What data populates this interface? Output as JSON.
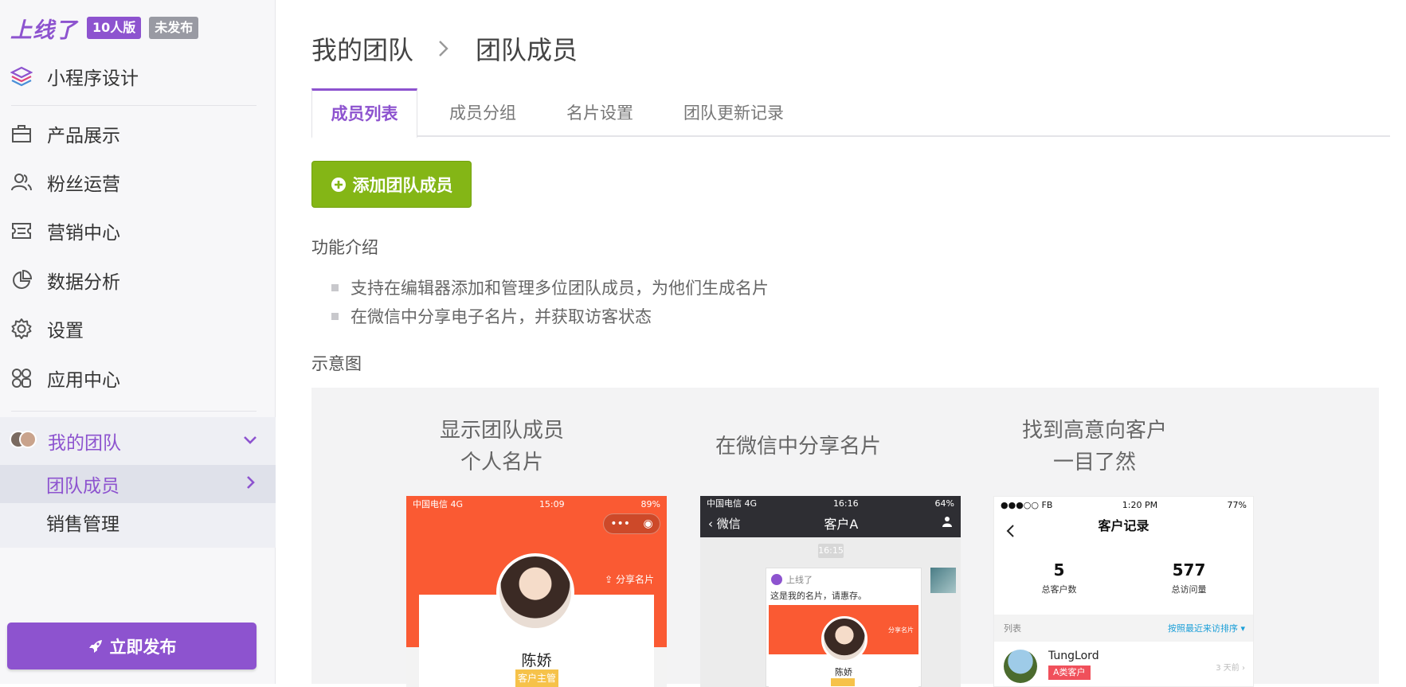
{
  "brand": {
    "logo": "上线了",
    "plan_badge": "10人版",
    "status_badge": "未发布"
  },
  "sidebar": {
    "design": "小程序设计",
    "items": [
      {
        "label": "产品展示",
        "icon": "briefcase-icon"
      },
      {
        "label": "粉丝运营",
        "icon": "users-icon"
      },
      {
        "label": "营销中心",
        "icon": "ticket-icon"
      },
      {
        "label": "数据分析",
        "icon": "pie-chart-icon"
      },
      {
        "label": "设置",
        "icon": "gear-icon"
      },
      {
        "label": "应用中心",
        "icon": "apps-icon"
      }
    ],
    "team": {
      "label": "我的团队",
      "sub": [
        "团队成员",
        "销售管理"
      ]
    },
    "publish": "立即发布"
  },
  "breadcrumb": {
    "parent": "我的团队",
    "current": "团队成员"
  },
  "tabs": [
    "成员列表",
    "成员分组",
    "名片设置",
    "团队更新记录"
  ],
  "add_button": "添加团队成员",
  "intro": {
    "title": "功能介绍",
    "bullets": [
      "支持在编辑器添加和管理多位团队成员，为他们生成名片",
      "在微信中分享电子名片，并获取访客状态"
    ]
  },
  "demo": {
    "title": "示意图",
    "columns": [
      {
        "caption_line1": "显示团队成员",
        "caption_line2": "个人名片",
        "phone": {
          "carrier": "中国电信  4G",
          "time": "15:09",
          "battery": "89%",
          "share": "分享名片",
          "name": "陈娇",
          "tag": "客户主管"
        }
      },
      {
        "caption_line1": "在微信中分享名片",
        "caption_line2": "",
        "phone": {
          "carrier": "中国电信  4G",
          "time": "16:16",
          "battery": "64%",
          "back": "微信",
          "title": "客户A",
          "stamp": "16:15",
          "from": "上线了",
          "msg": "这是我的名片，请惠存。",
          "share": "分享名片",
          "name": "陈娇"
        }
      },
      {
        "caption_line1": "找到高意向客户",
        "caption_line2": "一目了然",
        "phone": {
          "carrier": "FB",
          "time": "1:20 PM",
          "battery": "77%",
          "title": "客户记录",
          "stat1_value": "5",
          "stat1_label": "总客户数",
          "stat2_value": "577",
          "stat2_label": "总访问量",
          "list_label": "列表",
          "sort_label": "按照最近来访排序",
          "row_name": "TungLord",
          "row_tag": "A类客户",
          "row_time": "3 天前"
        }
      }
    ]
  },
  "colors": {
    "accent": "#8d53cf",
    "green": "#84b616",
    "orange": "#fa5a33"
  }
}
